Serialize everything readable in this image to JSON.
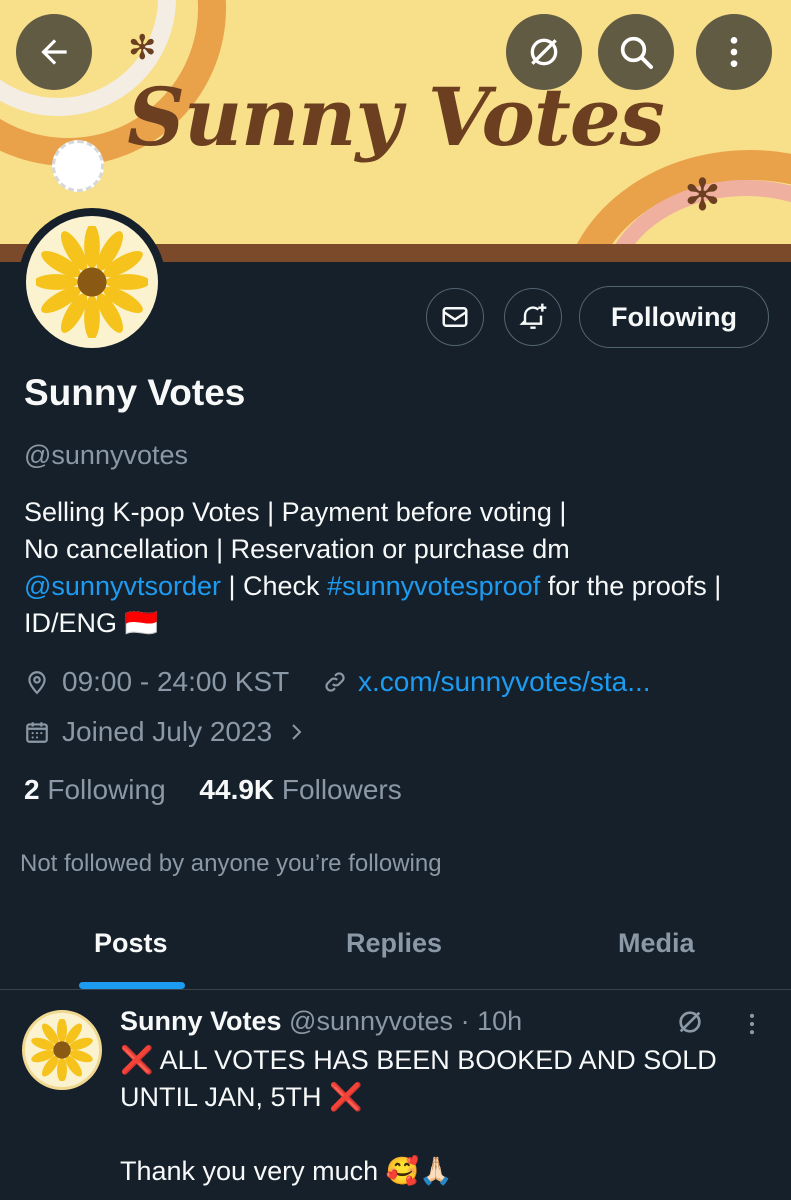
{
  "colors": {
    "background": "#15202b",
    "accent": "#1d9bf0",
    "muted": "#8b98a5",
    "banner_bg": "#f8df8a",
    "banner_text": "#6b3f1f"
  },
  "banner": {
    "title": "Sunny Votes"
  },
  "top_bar": {
    "icons": [
      "arrow-left-icon",
      "grok-icon",
      "search-icon",
      "more-vertical-icon"
    ]
  },
  "actions": {
    "message_icon": "envelope-icon",
    "notify_icon": "bell-plus-icon",
    "following_label": "Following"
  },
  "profile": {
    "name": "Sunny Votes",
    "handle": "@sunnyvotes",
    "bio": {
      "line1": "Selling K-pop Votes | Payment before voting |",
      "line2": "No cancellation | Reservation or purchase dm",
      "mention": "@sunnyvtsorder",
      "sep1": " | Check ",
      "hashtag": "#sunnyvotesproof",
      "after_hashtag": " for the proofs |",
      "line4": "ID/ENG",
      "flag": "🇮🇩"
    },
    "location": "09:00 - 24:00 KST",
    "website": "x.com/sunnyvotes/sta...",
    "joined": "Joined July 2023",
    "following_count": "2",
    "following_label": "Following",
    "followers_count": "44.9K",
    "followers_label": "Followers",
    "not_followed": "Not followed by anyone you’re following"
  },
  "tabs": [
    {
      "label": "Posts"
    },
    {
      "label": "Replies"
    },
    {
      "label": "Media"
    }
  ],
  "post": {
    "name": "Sunny Votes",
    "handle": "@sunnyvotes",
    "dot": "·",
    "time": "10h",
    "text": "❌ ALL VOTES HAS BEEN BOOKED AND SOLD UNTIL JAN, 5TH ❌\n\nThank you very much 🥰🙏🏻"
  }
}
